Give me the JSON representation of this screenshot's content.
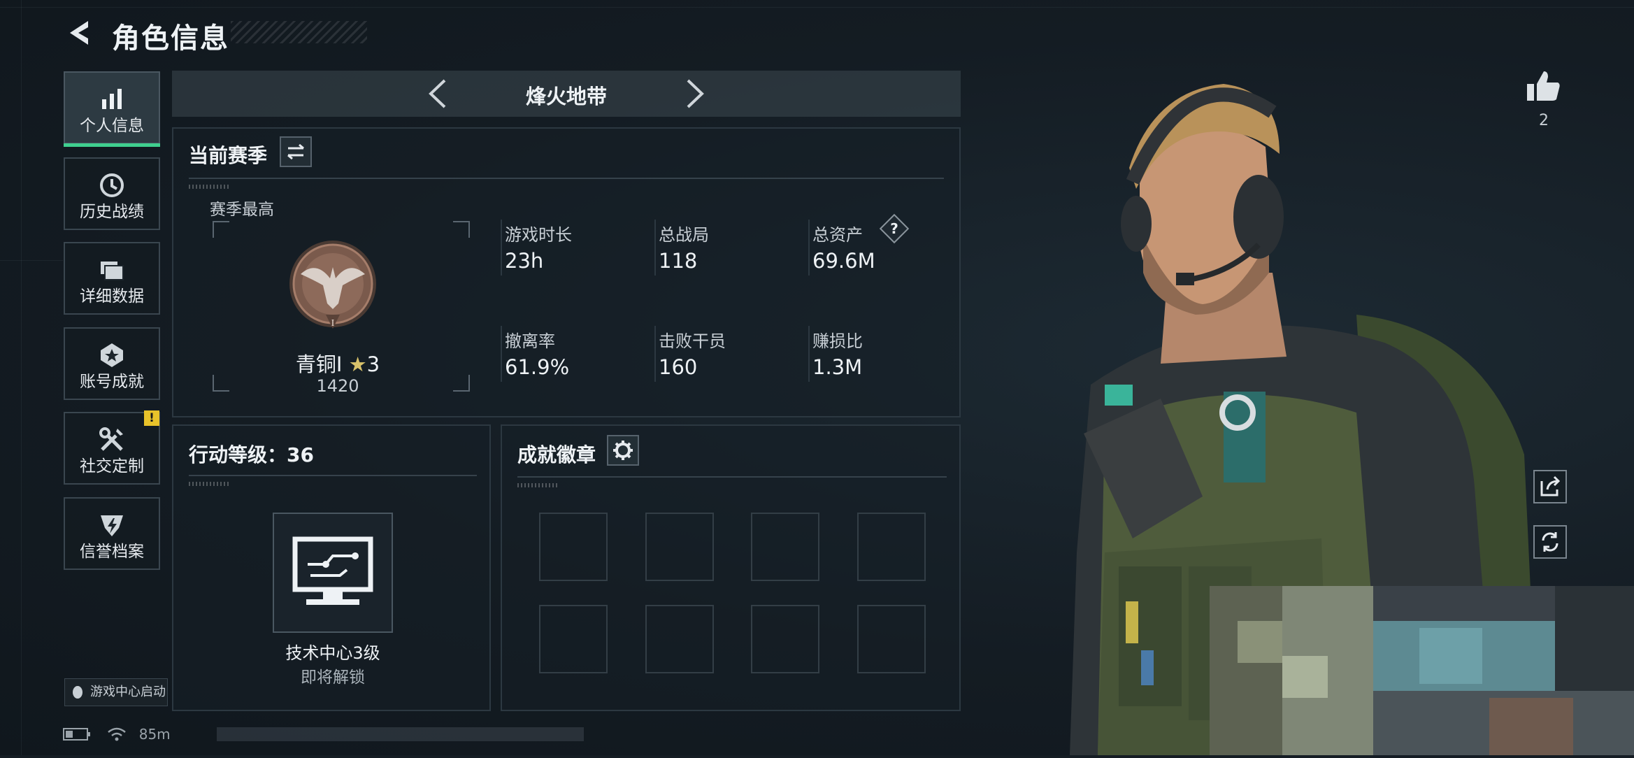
{
  "header": {
    "title": "角色信息"
  },
  "sidebar": {
    "items": [
      {
        "label": "个人信息",
        "icon": "bar-chart-icon",
        "active": true
      },
      {
        "label": "历史战绩",
        "icon": "clock-icon"
      },
      {
        "label": "详细数据",
        "icon": "folder-icon"
      },
      {
        "label": "账号成就",
        "icon": "star-badge-icon"
      },
      {
        "label": "社交定制",
        "icon": "tools-icon",
        "badge": "!"
      },
      {
        "label": "信誉档案",
        "icon": "shield-icon"
      }
    ],
    "game_center": "游戏中心启动",
    "signal_text": "85m"
  },
  "mode_selector": {
    "label": "烽火地带"
  },
  "season": {
    "title": "当前赛季",
    "best_label": "赛季最高",
    "rank_name": "青铜I",
    "rank_stars": "3",
    "rank_score": "1420",
    "stats": [
      {
        "label": "游戏时长",
        "value": "23h"
      },
      {
        "label": "总战局",
        "value": "118"
      },
      {
        "label": "总资产",
        "value": "69.6M",
        "help": "?"
      },
      {
        "label": "撤离率",
        "value": "61.9%"
      },
      {
        "label": "击败干员",
        "value": "160"
      },
      {
        "label": "赚损比",
        "value": "1.3M"
      }
    ]
  },
  "action_level": {
    "title": "行动等级：36",
    "item_name": "技术中心3级",
    "item_status": "即将解锁"
  },
  "achievements": {
    "title": "成就徽章",
    "slots": 8
  },
  "right": {
    "like_count": "2"
  },
  "colors": {
    "accent": "#3fd08f",
    "badge": "#e8c22a"
  }
}
